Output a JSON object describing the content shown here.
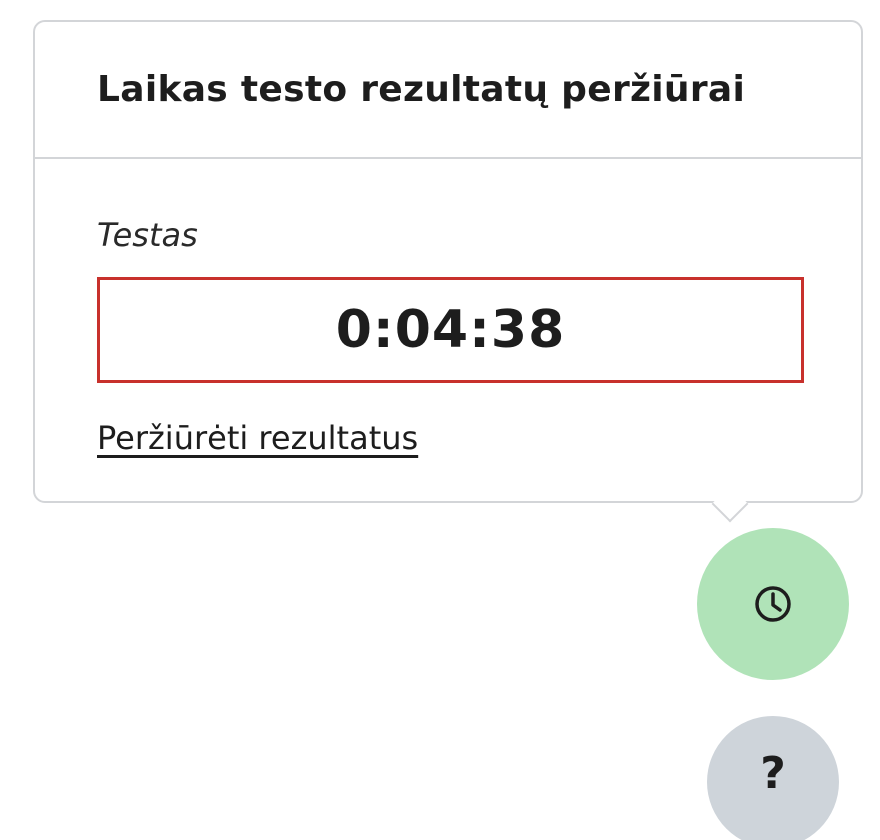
{
  "popover": {
    "title": "Laikas testo rezultatų peržiūrai",
    "test_name": "Testas",
    "timer": "0:04:38",
    "view_results_link": "Peržiūrėti rezultatus"
  },
  "fab": {
    "timer_icon": "clock-icon",
    "help_glyph": "?"
  },
  "colors": {
    "timer_border": "#c8312c",
    "timer_fab_bg": "#b0e3b8",
    "help_fab_bg": "#ced4da",
    "popover_border": "#d3d5d8"
  }
}
